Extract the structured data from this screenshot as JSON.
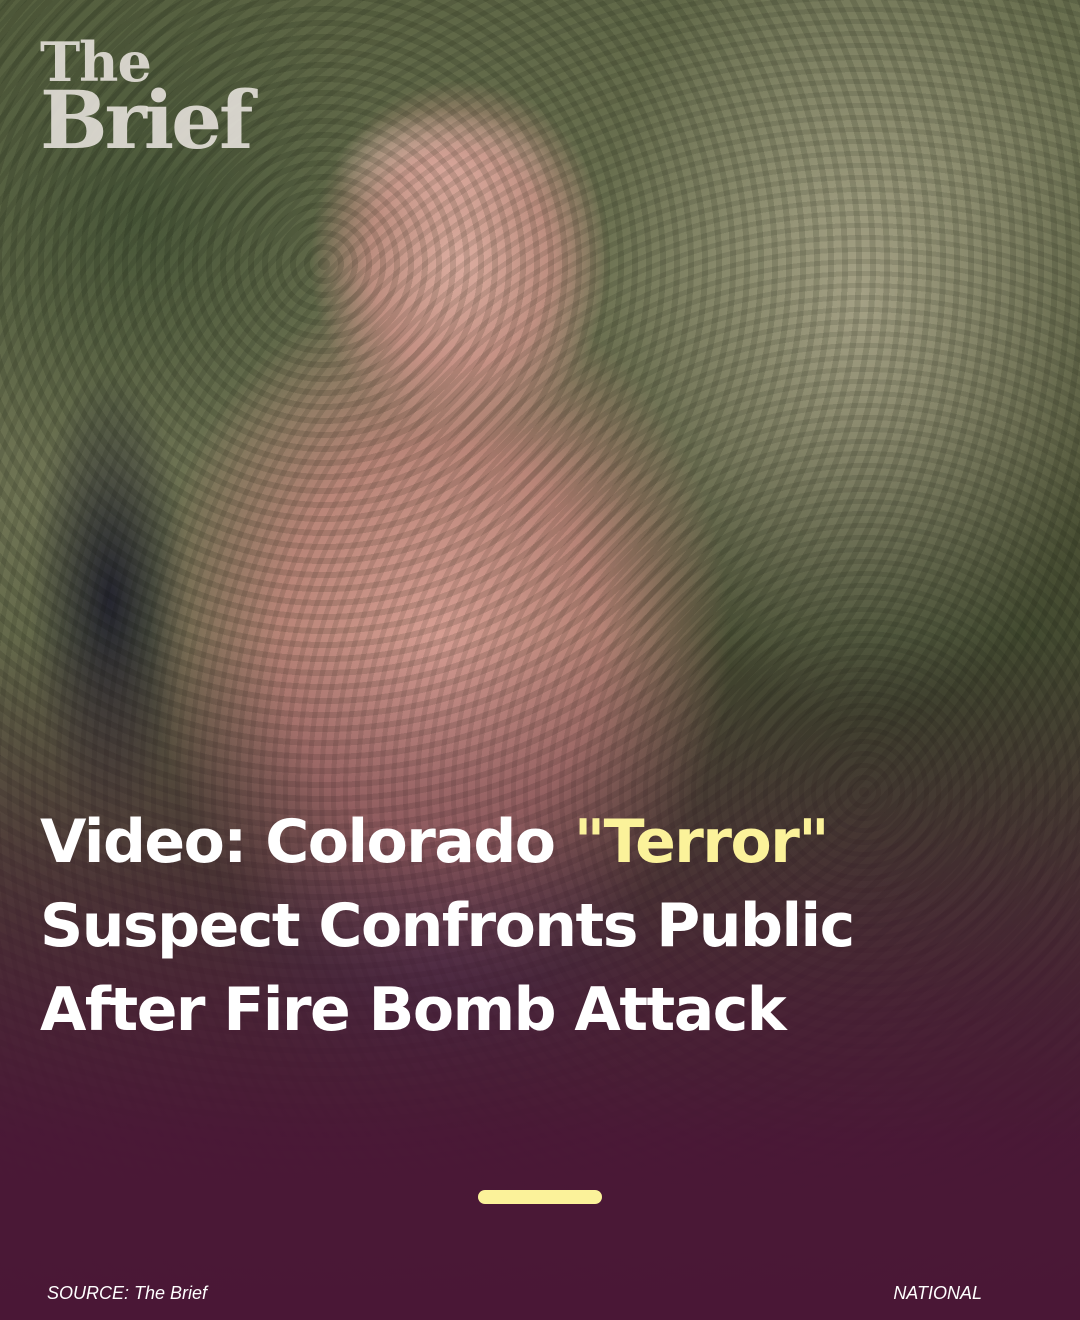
{
  "brand": {
    "logo_line1": "The",
    "logo_line2": "Brief"
  },
  "headline": {
    "part1": "Video: Colorado ",
    "highlight": "\"Terror\"",
    "line2": "Suspect Confronts Public",
    "line3": "After Fire Bomb Attack"
  },
  "footer": {
    "source": "SOURCE: The Brief",
    "category": "NATIONAL"
  },
  "colors": {
    "background": "#4a1736",
    "accent": "#fbf29a",
    "text": "#ffffff"
  }
}
